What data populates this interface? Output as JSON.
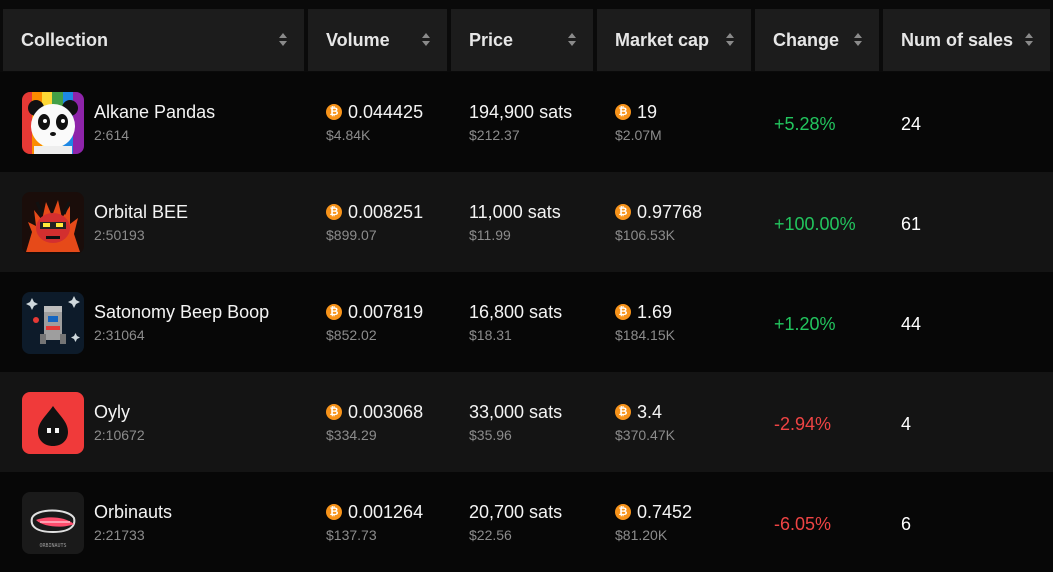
{
  "headers": [
    "Collection",
    "Volume",
    "Price",
    "Market cap",
    "Change",
    "Num of sales"
  ],
  "rows": [
    {
      "name": "Alkane Pandas",
      "id": "2:614",
      "volume": "0.044425",
      "volume_usd": "$4.84K",
      "price": "194,900 sats",
      "price_usd": "$212.37",
      "mcap": "19",
      "mcap_usd": "$2.07M",
      "change": "+5.28%",
      "sales": "24",
      "thumb_icon": "panda-icon"
    },
    {
      "name": "Orbital BEE",
      "id": "2:50193",
      "volume": "0.008251",
      "volume_usd": "$899.07",
      "price": "11,000 sats",
      "price_usd": "$11.99",
      "mcap": "0.97768",
      "mcap_usd": "$106.53K",
      "change": "+100.00%",
      "sales": "61",
      "thumb_icon": "bee-icon"
    },
    {
      "name": "Satonomy Beep Boop",
      "id": "2:31064",
      "volume": "0.007819",
      "volume_usd": "$852.02",
      "price": "16,800 sats",
      "price_usd": "$18.31",
      "mcap": "1.69",
      "mcap_usd": "$184.15K",
      "change": "+1.20%",
      "sales": "44",
      "thumb_icon": "robot-icon"
    },
    {
      "name": "Oyly",
      "id": "2:10672",
      "volume": "0.003068",
      "volume_usd": "$334.29",
      "price": "33,000 sats",
      "price_usd": "$35.96",
      "mcap": "3.4",
      "mcap_usd": "$370.47K",
      "change": "-2.94%",
      "sales": "4",
      "thumb_icon": "oil-drop-icon"
    },
    {
      "name": "Orbinauts",
      "id": "2:21733",
      "volume": "0.001264",
      "volume_usd": "$137.73",
      "price": "20,700 sats",
      "price_usd": "$22.56",
      "mcap": "0.7452",
      "mcap_usd": "$81.20K",
      "change": "-6.05%",
      "sales": "6",
      "thumb_icon": "visor-icon"
    }
  ],
  "thumb_caption": "ORBINAUTS",
  "colors": {
    "positive": "#22c55e",
    "negative": "#ef4444",
    "bitcoin": "#f7931a",
    "header_bg": "#1c1c1c"
  }
}
